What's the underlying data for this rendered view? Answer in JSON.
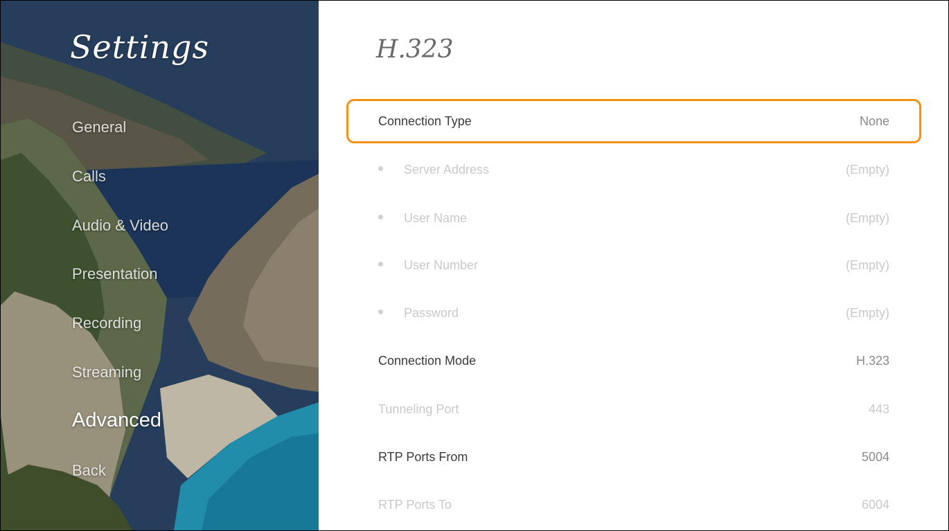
{
  "sidebar": {
    "title": "Settings",
    "items": [
      {
        "label": "General"
      },
      {
        "label": "Calls"
      },
      {
        "label": "Audio & Video"
      },
      {
        "label": "Presentation"
      },
      {
        "label": "Recording"
      },
      {
        "label": "Streaming"
      },
      {
        "label": "Advanced",
        "active": true
      },
      {
        "label": "Back"
      }
    ]
  },
  "main": {
    "title": "H.323",
    "rows": [
      {
        "label": "Connection Type",
        "value": "None",
        "focused": true
      },
      {
        "label": "Server Address",
        "value": "(Empty)",
        "disabled": true,
        "sub": true
      },
      {
        "label": "User Name",
        "value": "(Empty)",
        "disabled": true,
        "sub": true
      },
      {
        "label": "User Number",
        "value": "(Empty)",
        "disabled": true,
        "sub": true
      },
      {
        "label": "Password",
        "value": "(Empty)",
        "disabled": true,
        "sub": true
      },
      {
        "label": "Connection Mode",
        "value": "H.323"
      },
      {
        "label": "Tunneling Port",
        "value": "443",
        "disabled": true
      },
      {
        "label": "RTP Ports From",
        "value": "5004"
      },
      {
        "label": "RTP Ports To",
        "value": "6004",
        "disabled": true
      }
    ]
  },
  "colors": {
    "focus_border": "#f39018",
    "label_active": "#3a3a3a",
    "value_active": "#8a8a8a",
    "disabled_text": "#c9c9c9"
  }
}
